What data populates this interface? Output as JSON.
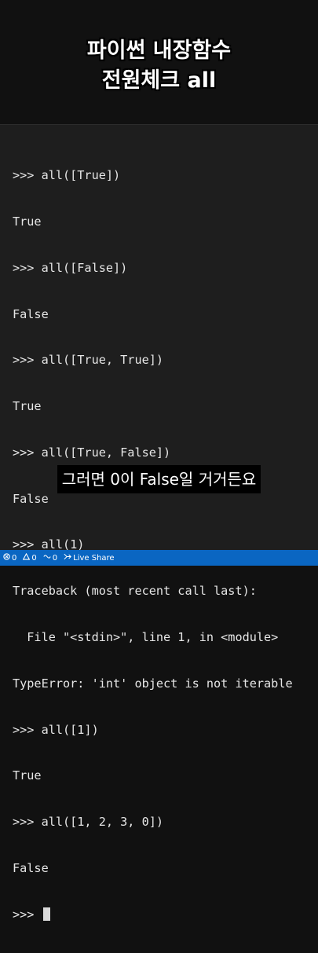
{
  "title": {
    "line1": "파이썬 내장함수",
    "line2": "전원체크 all"
  },
  "terminal": {
    "lines": [
      ">>> all([True])",
      "True",
      ">>> all([False])",
      "False",
      ">>> all([True, True])",
      "True",
      ">>> all([True, False])",
      "False",
      ">>> all(1)",
      "Traceback (most recent call last):",
      "  File \"<stdin>\", line 1, in <module>",
      "TypeError: 'int' object is not iterable",
      ">>> all([1])",
      "True",
      ">>> all([1, 2, 3, 0])",
      "False"
    ],
    "prompt": ">>> "
  },
  "caption": "그러면 0이 False일 거거든요",
  "status_bar": {
    "errors": "0",
    "warnings": "0",
    "ports": "0",
    "live_share": "Live Share",
    "icons": [
      "error-icon",
      "warning-icon",
      "port-icon",
      "live-share-icon"
    ],
    "color": "#0a66c2"
  }
}
